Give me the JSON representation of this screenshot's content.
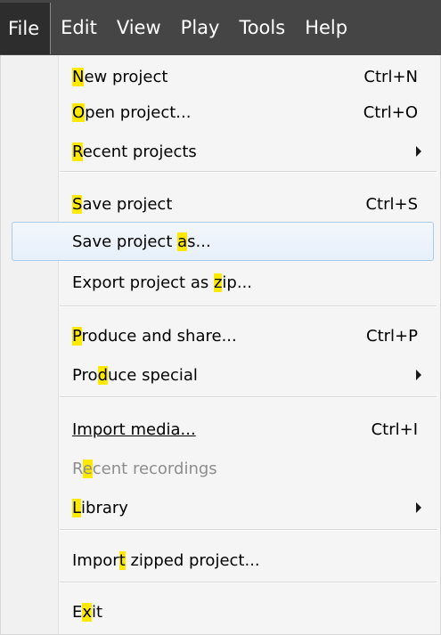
{
  "menubar": {
    "items": [
      {
        "label": "File"
      },
      {
        "label": "Edit"
      },
      {
        "label": "View"
      },
      {
        "label": "Play"
      },
      {
        "label": "Tools"
      },
      {
        "label": "Help"
      }
    ]
  },
  "highlight_color": "#ffe900",
  "menu": {
    "items": [
      {
        "pre": "",
        "key": "N",
        "post": "ew project",
        "shortcut": "Ctrl+N"
      },
      {
        "pre": "",
        "key": "O",
        "post": "pen project...",
        "shortcut": "Ctrl+O"
      },
      {
        "pre": "",
        "key": "R",
        "post": "ecent projects",
        "submenu": true
      },
      {
        "pre": "",
        "key": "S",
        "post": "ave project",
        "shortcut": "Ctrl+S"
      },
      {
        "pre": "Save project ",
        "key": "a",
        "post": "s...",
        "hover": true
      },
      {
        "pre": "Export project as ",
        "key": "z",
        "post": "ip..."
      },
      {
        "pre": "",
        "key": "P",
        "post": "roduce and share...",
        "shortcut": "Ctrl+P"
      },
      {
        "pre": "Pro",
        "key": "d",
        "post": "uce special",
        "submenu": true
      },
      {
        "pre": "Import media...",
        "key": "",
        "post": "",
        "shortcut": "Ctrl+I"
      },
      {
        "pre": "R",
        "key": "e",
        "post": "cent recordings",
        "disabled": true
      },
      {
        "pre": "",
        "key": "L",
        "post": "ibrary",
        "submenu": true
      },
      {
        "pre": "Impor",
        "key": "t",
        "post": " zipped project..."
      },
      {
        "pre": "E",
        "key": "x",
        "post": "it"
      }
    ]
  }
}
